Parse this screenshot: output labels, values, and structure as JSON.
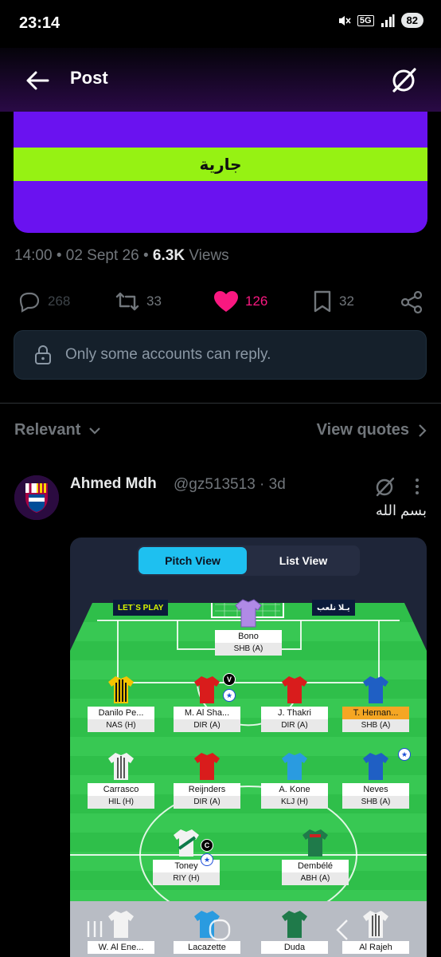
{
  "status": {
    "time": "23:14",
    "network": "5G",
    "battery": "82"
  },
  "header": {
    "title": "Post"
  },
  "banner": {
    "text": "جارية"
  },
  "meta": {
    "time": "14:00",
    "date": "02 Sept 26",
    "views_count": "6.3K",
    "views_label": "Views"
  },
  "actions": {
    "replies": "268",
    "reposts": "33",
    "likes": "126",
    "bookmarks": "32"
  },
  "reply_restriction": "Only some accounts can reply.",
  "sort": {
    "relevant": "Relevant",
    "view_quotes": "View quotes"
  },
  "reply": {
    "name": "Ahmed Mdh",
    "handle": "@gz513513",
    "age": "· 3d",
    "text": "بسم الله"
  },
  "fantasy": {
    "pitch_view": "Pitch View",
    "list_view": "List View",
    "ad_left": "LET`S  PLAY",
    "ad_right": "يـلا نلعب",
    "players": [
      {
        "name": "Bono",
        "fixture": "SHB (A)"
      },
      {
        "name": "Danilo Pe...",
        "fixture": "NAS (H)"
      },
      {
        "name": "M. Al Sha...",
        "fixture": "DIR (A)"
      },
      {
        "name": "J. Thakri",
        "fixture": "DIR (A)"
      },
      {
        "name": "T. Hernan...",
        "fixture": "SHB (A)"
      },
      {
        "name": "Carrasco",
        "fixture": "HIL (H)"
      },
      {
        "name": "Reijnders",
        "fixture": "DIR (A)"
      },
      {
        "name": "A. Kone",
        "fixture": "KLJ (H)"
      },
      {
        "name": "Neves",
        "fixture": "SHB (A)"
      },
      {
        "name": "Toney",
        "fixture": "RIY (H)"
      },
      {
        "name": "Dembélé",
        "fixture": "ABH (A)"
      },
      {
        "name": "W. Al Ene...",
        "fixture": ""
      },
      {
        "name": "Lacazette",
        "fixture": ""
      },
      {
        "name": "Duda",
        "fixture": ""
      },
      {
        "name": "Al Rajeh",
        "fixture": ""
      }
    ],
    "badges": {
      "vice": "V",
      "captain": "C"
    }
  },
  "colors": {
    "like": "#f91880",
    "accent": "#1ec0f0",
    "banner_purple": "#6a12f0",
    "banner_green": "#96f213",
    "pitch": "#2fbf4a"
  }
}
